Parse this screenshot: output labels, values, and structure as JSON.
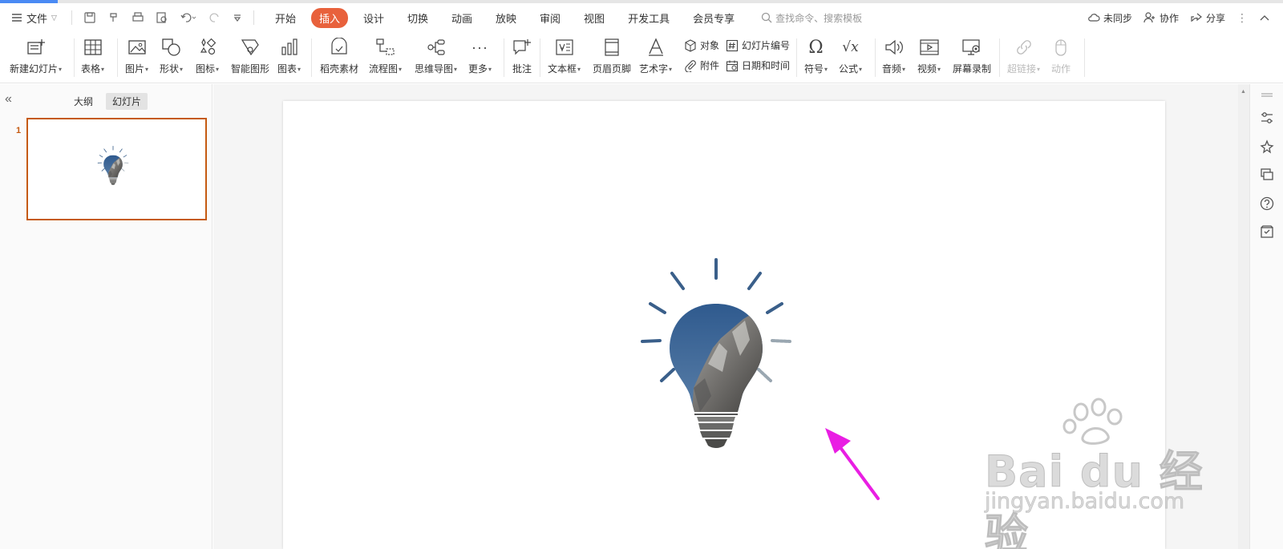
{
  "menubar": {
    "file_label": "文件",
    "tabs": [
      {
        "label": "开始",
        "active": false
      },
      {
        "label": "插入",
        "active": true
      },
      {
        "label": "设计",
        "active": false
      },
      {
        "label": "切换",
        "active": false
      },
      {
        "label": "动画",
        "active": false
      },
      {
        "label": "放映",
        "active": false
      },
      {
        "label": "审阅",
        "active": false
      },
      {
        "label": "视图",
        "active": false
      },
      {
        "label": "开发工具",
        "active": false
      },
      {
        "label": "会员专享",
        "active": false
      }
    ],
    "search_placeholder": "查找命令、搜索模板",
    "sync_label": "未同步",
    "collab_label": "协作",
    "share_label": "分享"
  },
  "ribbon": {
    "new_slide": "新建幻灯片",
    "table": "表格",
    "picture": "图片",
    "shape": "形状",
    "icon": "图标",
    "smartart": "智能图形",
    "chart": "图表",
    "docer": "稻壳素材",
    "flowchart": "流程图",
    "mindmap": "思维导图",
    "more": "更多",
    "comment": "批注",
    "textbox": "文本框",
    "header_footer": "页眉页脚",
    "wordart": "艺术字",
    "object": "对象",
    "slide_number": "幻灯片编号",
    "attachment": "附件",
    "datetime": "日期和时间",
    "symbol": "符号",
    "formula": "公式",
    "audio": "音频",
    "video": "视频",
    "screen_record": "屏幕录制",
    "hyperlink": "超链接",
    "action": "动作"
  },
  "leftpanel": {
    "tab_outline": "大纲",
    "tab_slides": "幻灯片",
    "slide_number": "1"
  },
  "watermark": {
    "logo_text": "Bai du 经验",
    "url": "jingyan.baidu.com"
  },
  "colors": {
    "accent": "#e8613c",
    "selection": "#c55a11",
    "bulb_rays": "#3a5f8a",
    "arrow": "#e91ee3"
  }
}
